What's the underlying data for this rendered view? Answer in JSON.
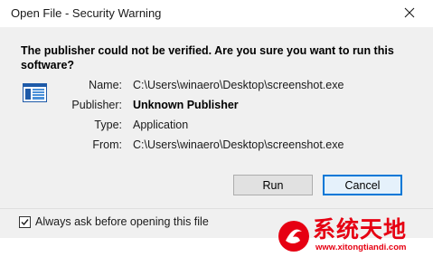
{
  "window": {
    "title": "Open File - Security Warning"
  },
  "warning": {
    "question": "The publisher could not be verified.  Are you sure you want to run this software?"
  },
  "details": {
    "name_label": "Name:",
    "name_value": "C:\\Users\\winaero\\Desktop\\screenshot.exe",
    "publisher_label": "Publisher:",
    "publisher_value": "Unknown Publisher",
    "type_label": "Type:",
    "type_value": "Application",
    "from_label": "From:",
    "from_value": "C:\\Users\\winaero\\Desktop\\screenshot.exe"
  },
  "buttons": {
    "run_label": "Run",
    "cancel_label": "Cancel"
  },
  "options": {
    "always_ask_label": "Always ask before opening this file",
    "always_ask_checked": true
  },
  "watermark": {
    "site_name": "系统天地",
    "url": "www.xitongtiandi.com",
    "color": "#e60012"
  },
  "icons": {
    "close": "close-icon",
    "file": "application-file-icon",
    "check": "checkmark-icon",
    "logo": "watermark-logo-icon"
  },
  "colors": {
    "accent": "#0078d7",
    "content_bg": "#f0f0f0"
  }
}
